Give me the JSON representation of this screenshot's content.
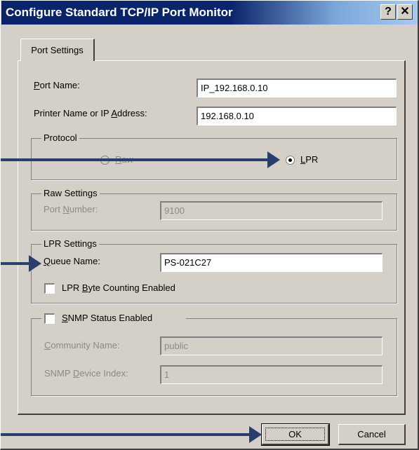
{
  "window": {
    "title": "Configure Standard TCP/IP Port Monitor",
    "help_label": "?",
    "close_label": "✕"
  },
  "tabs": [
    {
      "label": "Port Settings"
    }
  ],
  "fields": {
    "port_name": {
      "pre": "",
      "mnemonic": "P",
      "post": "ort Name:",
      "value": "IP_192.168.0.10"
    },
    "printer_address": {
      "pre": "Printer Name or IP ",
      "mnemonic": "A",
      "post": "ddress:",
      "value": "192.168.0.10"
    }
  },
  "protocol": {
    "label": "Protocol",
    "options": [
      {
        "pre": "",
        "mnemonic": "R",
        "post": "aw",
        "selected": false,
        "enabled": false
      },
      {
        "pre": "",
        "mnemonic": "L",
        "post": "PR",
        "selected": true,
        "enabled": true
      }
    ]
  },
  "raw_settings": {
    "label": "Raw Settings",
    "port_number": {
      "pre": "Port ",
      "mnemonic": "N",
      "post": "umber:",
      "value": "9100"
    }
  },
  "lpr_settings": {
    "label": "LPR Settings",
    "queue_name": {
      "pre": "",
      "mnemonic": "Q",
      "post": "ueue Name:",
      "value": "PS-021C27"
    },
    "byte_counting": {
      "pre": "LPR ",
      "mnemonic": "B",
      "post": "yte Counting Enabled",
      "checked": false
    }
  },
  "snmp": {
    "label": {
      "pre": "",
      "mnemonic": "S",
      "post": "NMP Status Enabled"
    },
    "checked": false,
    "community_name": {
      "pre": "",
      "mnemonic": "C",
      "post": "ommunity Name:",
      "value": "public"
    },
    "device_index": {
      "pre": "SNMP ",
      "mnemonic": "D",
      "post": "evice Index:",
      "value": "1"
    }
  },
  "buttons": {
    "ok": "OK",
    "cancel": "Cancel"
  },
  "colors": {
    "title_bar": "#0a246a",
    "dialog_face": "#d4d0c8",
    "arrow": "#2a3e6e"
  }
}
